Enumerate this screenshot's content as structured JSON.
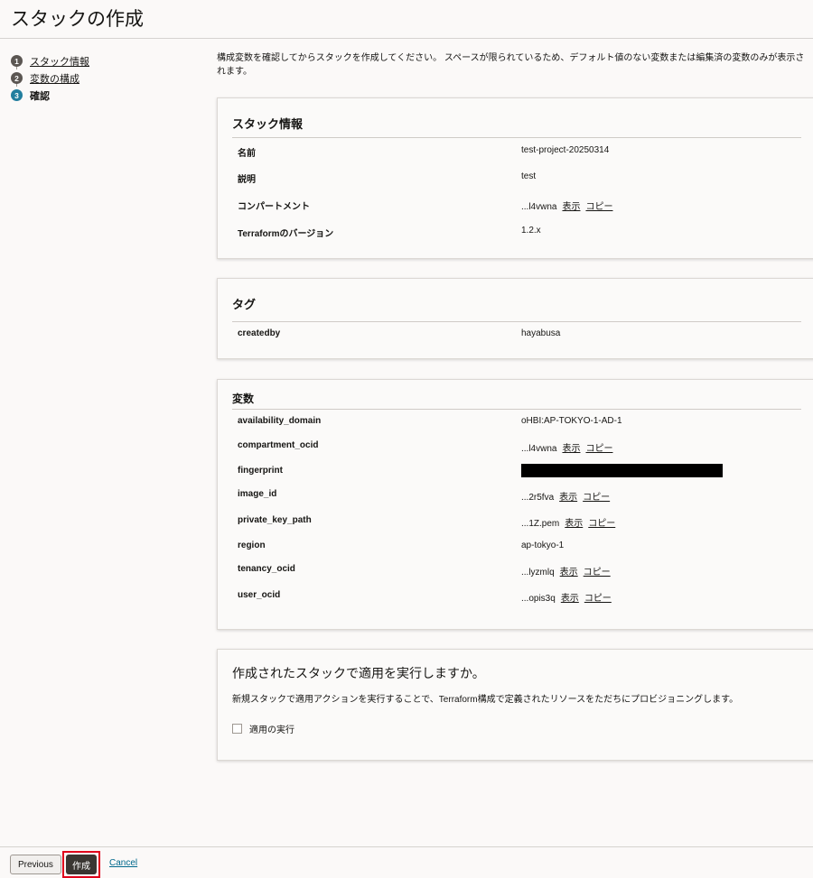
{
  "page": {
    "title": "スタックの作成"
  },
  "steps": [
    {
      "num": "1",
      "label": "スタック情報"
    },
    {
      "num": "2",
      "label": "変数の構成"
    },
    {
      "num": "3",
      "label": "確認"
    }
  ],
  "intro": "構成変数を確認してからスタックを作成してください。 スペースが限られているため、デフォルト値のない変数または編集済の変数のみが表示されます。",
  "stack_info": {
    "heading": "スタック情報",
    "rows": [
      {
        "key": "名前",
        "value": "test-project-20250314"
      },
      {
        "key": "説明",
        "value": "test"
      },
      {
        "key": "コンパートメント",
        "value": "...l4vwna",
        "show": "表示",
        "copy": "コピー"
      },
      {
        "key": "Terraformのバージョン",
        "value": "1.2.x"
      }
    ]
  },
  "tags": {
    "heading": "タグ",
    "rows": [
      {
        "key": "createdby",
        "value": "hayabusa"
      }
    ]
  },
  "variables": {
    "heading": "変数",
    "rows": [
      {
        "key": "availability_domain",
        "value": "oHBI:AP-TOKYO-1-AD-1"
      },
      {
        "key": "compartment_ocid",
        "value": "...l4vwna",
        "show": "表示",
        "copy": "コピー"
      },
      {
        "key": "fingerprint",
        "value": ""
      },
      {
        "key": "image_id",
        "value": "...2r5fva",
        "show": "表示",
        "copy": "コピー"
      },
      {
        "key": "private_key_path",
        "value": "...1Z.pem",
        "show": "表示",
        "copy": "コピー"
      },
      {
        "key": "region",
        "value": "ap-tokyo-1"
      },
      {
        "key": "tenancy_ocid",
        "value": "...lyzmlq",
        "show": "表示",
        "copy": "コピー"
      },
      {
        "key": "user_ocid",
        "value": "...opis3q",
        "show": "表示",
        "copy": "コピー"
      }
    ]
  },
  "apply": {
    "title": "作成されたスタックで適用を実行しますか。",
    "description": "新規スタックで適用アクションを実行することで、Terraform構成で定義されたリソースをただちにプロビジョニングします。",
    "checkbox_label": "適用の実行",
    "checked": false
  },
  "footer": {
    "previous": "Previous",
    "create": "作成",
    "cancel": "Cancel"
  }
}
